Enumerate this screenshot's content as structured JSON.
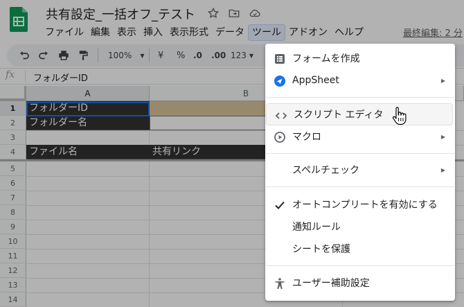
{
  "app": {
    "title": "共有設定_一括オフ_テスト",
    "last_edit": "最終編集: 2 分"
  },
  "menubar": [
    "ファイル",
    "編集",
    "表示",
    "挿入",
    "表示形式",
    "データ",
    "ツール",
    "アドオン",
    "ヘルプ"
  ],
  "toolbar": {
    "zoom": "100%",
    "currency": "¥",
    "percent": "%",
    "dec_less": ".0",
    "dec_more": ".00",
    "format_more": "123"
  },
  "formula_bar": {
    "fx": "fx",
    "value": "フォルダーID"
  },
  "grid": {
    "columns": [
      "A",
      "B"
    ],
    "rows": [
      "1",
      "2",
      "3",
      "4",
      "5",
      "6",
      "7",
      "8",
      "9",
      "10",
      "11",
      "12",
      "13",
      "14"
    ],
    "cells": {
      "A1": "フォルダーID",
      "A2": "フォルダー名",
      "A4": "ファイル名",
      "B4": "共有リンク"
    }
  },
  "tools_menu": {
    "items": [
      {
        "label": "フォームを作成",
        "icon": "form-icon",
        "submenu": false
      },
      {
        "label": "AppSheet",
        "icon": "appsheet-icon",
        "submenu": true
      },
      {
        "label": "スクリプト エディタ",
        "icon": "code-icon",
        "submenu": false,
        "hover": true
      },
      {
        "label": "マクロ",
        "icon": "play-circle-icon",
        "submenu": true
      },
      {
        "label": "スペルチェック",
        "icon": "",
        "submenu": true
      },
      {
        "label": "オートコンプリートを有効にする",
        "icon": "check-icon",
        "submenu": false,
        "checked": true
      },
      {
        "label": "通知ルール",
        "icon": "",
        "submenu": false
      },
      {
        "label": "シートを保護",
        "icon": "",
        "submenu": false
      },
      {
        "label": "ユーザー補助設定",
        "icon": "accessibility-icon",
        "submenu": false
      }
    ]
  },
  "colors": {
    "header_fill": "#333333",
    "b1_fill": "#d9c49a",
    "accent": "#1a73e8",
    "sheets_green": "#0f9d58"
  }
}
